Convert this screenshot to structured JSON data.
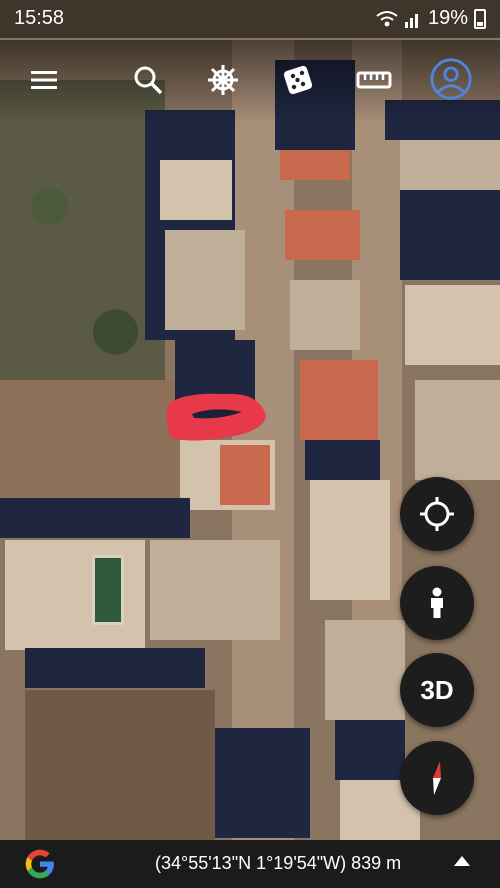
{
  "status": {
    "time": "15:58",
    "battery": "19%"
  },
  "toolbar": {
    "menu_icon": "menu-icon",
    "search_icon": "search-icon",
    "voyager_icon": "ship-wheel-icon",
    "feeling_lucky_icon": "dice-icon",
    "measure_icon": "ruler-icon",
    "account_icon": "account-icon"
  },
  "map_controls": {
    "my_location_icon": "crosshair-icon",
    "street_view_icon": "pegman-icon",
    "three_d_label": "3D",
    "compass_icon": "compass-icon"
  },
  "footer": {
    "coordinates": "(34°55'13\"N 1°19'54\"W) 839 m"
  },
  "colors": {
    "accent": "#4f86d9",
    "compass_red": "#e53935",
    "fab_bg": "#1d1d1d"
  }
}
